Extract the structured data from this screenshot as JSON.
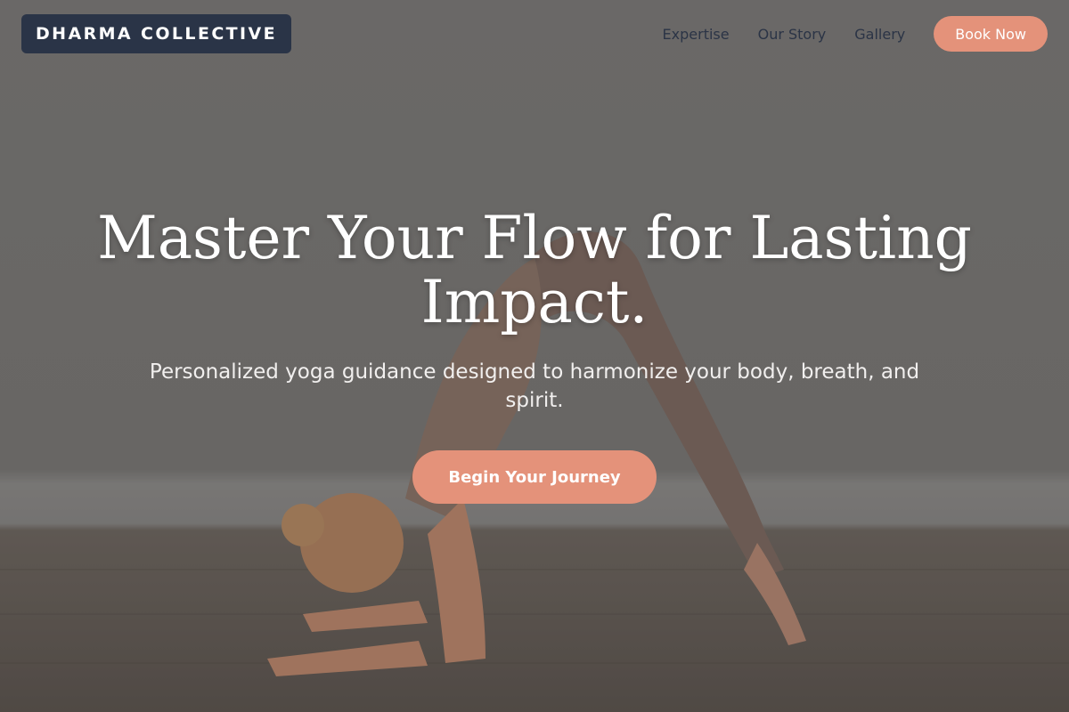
{
  "brand": {
    "name": "DHARMA COLLECTIVE",
    "color": "#2a3447"
  },
  "nav": {
    "items": [
      "Expertise",
      "Our Story",
      "Gallery"
    ],
    "cta_label": "Book Now",
    "cta_color": "#e4927a"
  },
  "hero": {
    "headline": "Master Your Flow for Lasting Impact.",
    "subheadline": "Personalized yoga guidance designed to harmonize your body, breath, and spirit.",
    "cta_label": "Begin Your Journey",
    "background_image": "woman-yoga-forearm-pose-photo"
  }
}
